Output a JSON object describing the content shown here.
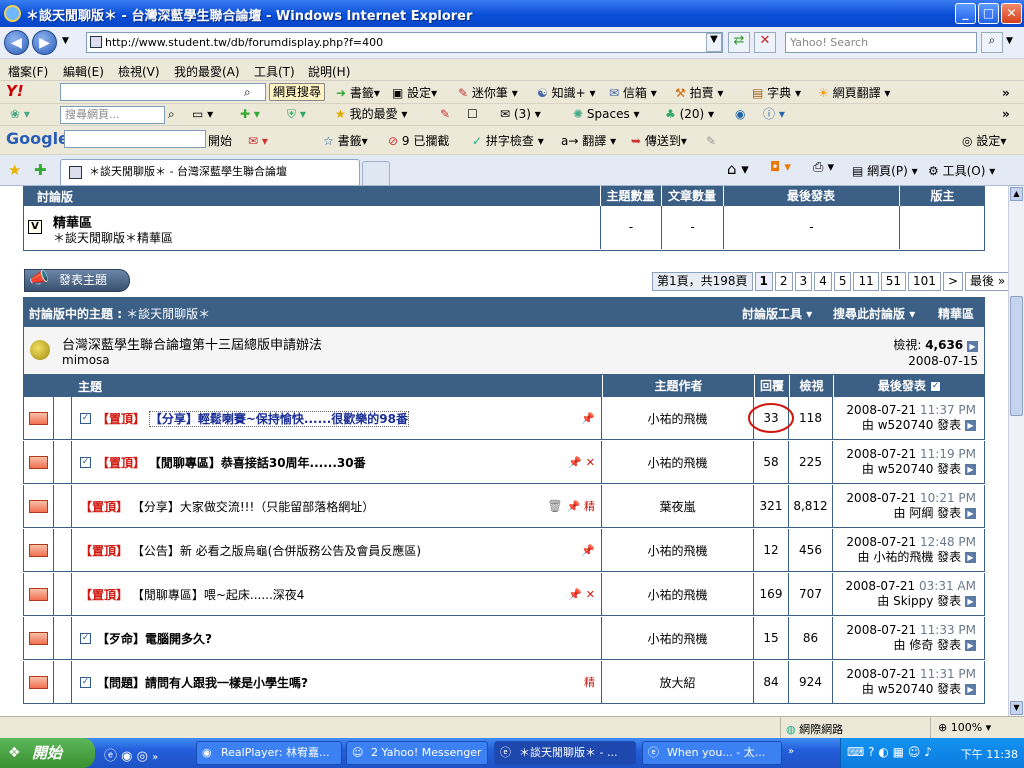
{
  "window": {
    "title": "＊談天閒聊版＊ - 台灣深藍學生聯合論壇 - Windows Internet Explorer",
    "min": "_",
    "max": "□",
    "close": "✕"
  },
  "address": {
    "url": "http://www.student.tw/db/forumdisplay.php?f=400",
    "search_placeholder": "Yahoo! Search"
  },
  "menu": [
    "檔案(F)",
    "編輯(E)",
    "檢視(V)",
    "我的最愛(A)",
    "工具(T)",
    "說明(H)"
  ],
  "yahoo_toolbar": {
    "search_btn": "網頁搜尋",
    "items": [
      "書籤▾",
      "設定▾",
      "迷你筆",
      "知識+",
      "信箱",
      "拍賣",
      "字典",
      "網頁翻譯"
    ]
  },
  "toolbar2": {
    "search_placeholder": "搜尋網頁...",
    "items": [
      "(3)",
      "Spaces",
      "(20)"
    ],
    "fav": "我的最愛"
  },
  "google_toolbar": {
    "logo": "Google",
    "start": "開始",
    "items": [
      "書籤▾",
      "9 已攔截",
      "拼字檢查",
      "翻譯",
      "傳送到▾"
    ],
    "settings": "設定▾"
  },
  "tab": {
    "title": "＊談天閒聊版＊ - 台灣深藍學生聯合論壇"
  },
  "cmd": {
    "page": "網頁(P)",
    "tools": "工具(O)"
  },
  "forum_table": {
    "headers": [
      "討論版",
      "主題數量",
      "文章數量",
      "最後發表",
      "版主"
    ],
    "row": {
      "name": "精華區",
      "desc": "＊談天閒聊版＊精華區",
      "topics": "-",
      "posts": "-",
      "last": "-"
    }
  },
  "new_thread_btn": "發表主題",
  "pager": {
    "info": "第1頁，共198頁",
    "pages": [
      "1",
      "2",
      "3",
      "4",
      "5",
      "11",
      "51",
      "101"
    ],
    "next": ">",
    "last": "最後 »"
  },
  "thread_section": {
    "title_prefix": "討論版中的主題",
    "title": "＊談天閒聊版＊",
    "tools": "討論版工具",
    "search": "搜尋此討論版",
    "essence": "精華區"
  },
  "announcement": {
    "title": "台灣深藍學生聯合論壇第十三屆總版申請辦法",
    "author": "mimosa",
    "views_label": "檢視:",
    "views": "4,636",
    "date": "2008-07-15"
  },
  "columns": {
    "topic": "主題",
    "author": "主題作者",
    "replies": "回覆",
    "views": "檢視",
    "last": "最後發表"
  },
  "threads": [
    {
      "prefix": "【置頂】",
      "title": "【分享】輕鬆喇賽~保持愉快......很歡樂的98番",
      "author": "小祐的飛機",
      "replies": "33",
      "views": "118",
      "date": "2008-07-21",
      "time": "11:37 PM",
      "by": "由 w520740 發表"
    },
    {
      "prefix": "【置頂】",
      "title": "【閒聊專區】恭喜接話30周年......30番",
      "author": "小祐的飛機",
      "replies": "58",
      "views": "225",
      "date": "2008-07-21",
      "time": "11:19 PM",
      "by": "由 w520740 發表"
    },
    {
      "prefix": "【置頂】",
      "title": "【分享】大家做交流!!!（只能留部落格網址）",
      "author": "葉夜嵐",
      "replies": "321",
      "views": "8,812",
      "date": "2008-07-21",
      "time": "10:21 PM",
      "by": "由 阿綱 發表"
    },
    {
      "prefix": "【置頂】",
      "title": "【公告】新 必看之版烏龜(合併版務公告及會員反應區)",
      "author": "小祐的飛機",
      "replies": "12",
      "views": "456",
      "date": "2008-07-21",
      "time": "12:48 PM",
      "by": "由 小祐的飛機 發表"
    },
    {
      "prefix": "【置頂】",
      "title": "【閒聊專區】喂~起床......深夜4",
      "author": "小祐的飛機",
      "replies": "169",
      "views": "707",
      "date": "2008-07-21",
      "time": "03:31 AM",
      "by": "由 Skippy 發表"
    },
    {
      "prefix": "",
      "title": "【歹命】電腦開多久?",
      "author": "小祐的飛機",
      "replies": "15",
      "views": "86",
      "date": "2008-07-21",
      "time": "11:33 PM",
      "by": "由 修奇 發表"
    },
    {
      "prefix": "",
      "title": "【問題】請問有人跟我一樣是小學生嗎?",
      "author": "放大紹",
      "replies": "84",
      "views": "924",
      "date": "2008-07-21",
      "time": "11:31 PM",
      "by": "由 w520740 發表"
    }
  ],
  "status": {
    "zone": "網際網路",
    "zoom": "100%"
  },
  "taskbar": {
    "start": "開始",
    "tasks": [
      "RealPlayer: 林宥嘉...",
      "2 Yahoo! Messenger",
      "＊談天閒聊版＊ - ...",
      "When you... - 太..."
    ],
    "clock": "下午 11:38"
  },
  "colors": {
    "header": "#3c5f86",
    "sticky": "#d0170f",
    "annotation": "#d0170f"
  }
}
